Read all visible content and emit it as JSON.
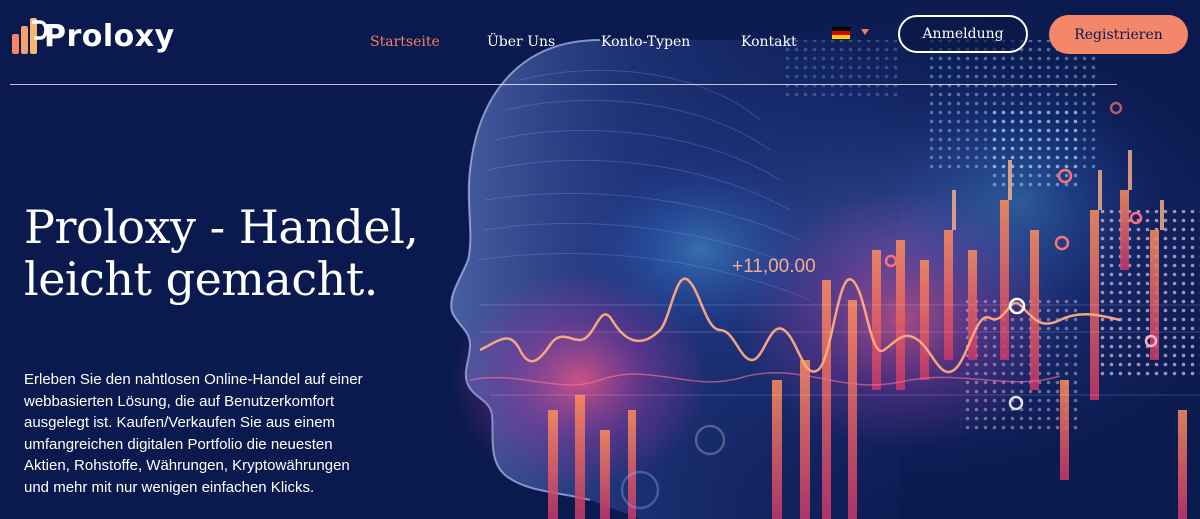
{
  "brand": {
    "name": "Proloxy"
  },
  "nav": {
    "items": [
      {
        "label": "Startseite",
        "active": true
      },
      {
        "label": "Über Uns",
        "active": false
      },
      {
        "label": "Konto-Typen",
        "active": false
      },
      {
        "label": "Kontakt",
        "active": false
      }
    ],
    "language": "flag-germany-icon"
  },
  "actions": {
    "login_label": "Anmeldung",
    "register_label": "Registrieren"
  },
  "hero": {
    "title": "Proloxy - Handel, leicht gemacht.",
    "description": "Erleben Sie den nahtlosen Online-Handel auf einer webbasierten Lösung, die auf Benutzerkomfort ausgelegt ist. Kaufen/Verkaufen Sie aus einem umfangreichen digitalen Portfolio die neuesten Aktien, Rohstoffe, Währungen, Kryptowährungen und mehr mit nur wenigen einfachen Klicks.",
    "art_label": "+11,00.00"
  },
  "colors": {
    "background": "#0b1a4e",
    "accent": "#f4866a",
    "active_nav": "#f47e60",
    "text": "#ffffff"
  }
}
